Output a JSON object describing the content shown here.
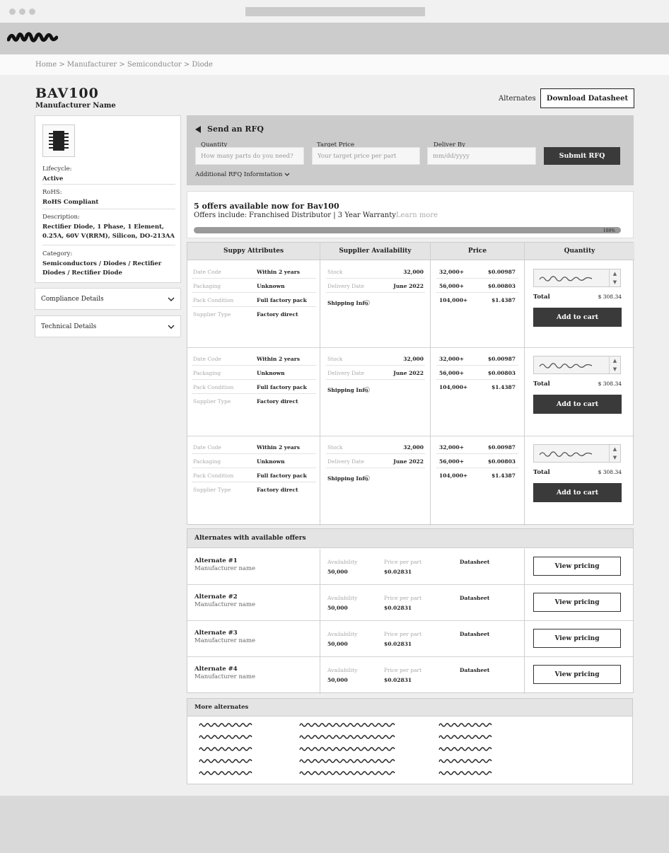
{
  "breadcrumb": "Home > Manufacturer > Semiconductor > Diode",
  "product": {
    "title": "BAV100",
    "manufacturer": "Manufacturer Name"
  },
  "header_actions": {
    "alternates": "Alternates",
    "download": "Download Datasheet"
  },
  "info": {
    "lifecycle_label": "Lifecycle:",
    "lifecycle": "Active",
    "rohs_label": "RoHS:",
    "rohs": "RoHS Compliant",
    "description_label": "Description:",
    "description": "Rectifier Diode, 1 Phase, 1 Element, 0.25A, 60V V(RRM), Silicon, DO-213AA",
    "category_label": "Category:",
    "category": "Semiconductors / Diodes / Rectifier Diodes / Rectifier Diode"
  },
  "accordions": [
    "Compliance Details",
    "Technical Details"
  ],
  "rfq": {
    "title": "Send an RFQ",
    "fields": [
      {
        "label": "Quantity",
        "placeholder": "How many parts do you need?"
      },
      {
        "label": "Target Price",
        "placeholder": "Your target price per part"
      },
      {
        "label": "Deliver By",
        "placeholder": "mm/dd/yyyy"
      }
    ],
    "submit": "Submit RFQ",
    "additional": "Additional RFQ Informtation"
  },
  "offers_summary": {
    "title": "5 offers available now for Bav100",
    "subtitle": "Offers include: Franchised Distributor |  3 Year Warranty",
    "learn_more": "Learn more",
    "progress": 100,
    "progress_label": "100%"
  },
  "offer_grid": {
    "headers": [
      "Suppy Attributes",
      "Supplier Availability",
      "Price",
      "Quantity"
    ],
    "rows": [
      {
        "attributes": [
          [
            "Date Code",
            "Within 2 years"
          ],
          [
            "Packaging",
            "Unknown"
          ],
          [
            "Pack Condition",
            "Full factory pack"
          ],
          [
            "Supplier Type",
            "Factory direct"
          ]
        ],
        "availability": [
          [
            "Stock",
            "32,000"
          ],
          [
            "Delivery Date",
            "June 2022"
          ]
        ],
        "shipping": "Shipping Info",
        "prices": [
          [
            "32,000+",
            "$0.00987"
          ],
          [
            "56,000+",
            "$0.00803"
          ],
          [
            "104,000+",
            "$1.4387"
          ]
        ],
        "total_label": "Total",
        "total": "$ 308.34",
        "cart": "Add to cart"
      },
      {
        "attributes": [
          [
            "Date Code",
            "Within 2 years"
          ],
          [
            "Packaging",
            "Unknown"
          ],
          [
            "Pack Condition",
            "Full factory pack"
          ],
          [
            "Supplier Type",
            "Factory direct"
          ]
        ],
        "availability": [
          [
            "Stock",
            "32,000"
          ],
          [
            "Delivery Date",
            "June 2022"
          ]
        ],
        "shipping": "Shipping Info",
        "prices": [
          [
            "32,000+",
            "$0.00987"
          ],
          [
            "56,000+",
            "$0.00803"
          ],
          [
            "104,000+",
            "$1.4387"
          ]
        ],
        "total_label": "Total",
        "total": "$ 308.34",
        "cart": "Add to cart"
      },
      {
        "attributes": [
          [
            "Date Code",
            "Within 2 years"
          ],
          [
            "Packaging",
            "Unknown"
          ],
          [
            "Pack Condition",
            "Full factory pack"
          ],
          [
            "Supplier Type",
            "Factory direct"
          ]
        ],
        "availability": [
          [
            "Stock",
            "32,000"
          ],
          [
            "Delivery Date",
            "June 2022"
          ]
        ],
        "shipping": "Shipping Info",
        "prices": [
          [
            "32,000+",
            "$0.00987"
          ],
          [
            "56,000+",
            "$0.00803"
          ],
          [
            "104,000+",
            "$1.4387"
          ]
        ],
        "total_label": "Total",
        "total": "$ 308.34",
        "cart": "Add to cart"
      }
    ]
  },
  "alternates": {
    "title": "Alternates with available offers",
    "items": [
      {
        "name": "Alternate #1",
        "mfr": "Manufacturer name",
        "avail_label": "Availability",
        "avail": "50,000",
        "price_label": "Price per part",
        "price": "$0.02831",
        "datasheet": "Datasheet",
        "button": "View pricing"
      },
      {
        "name": "Alternate #2",
        "mfr": "Manufacturer name",
        "avail_label": "Availability",
        "avail": "50,000",
        "price_label": "Price per part",
        "price": "$0.02831",
        "datasheet": "Datasheet",
        "button": "View pricing"
      },
      {
        "name": "Alternate #3",
        "mfr": "Manufacturer name",
        "avail_label": "Availability",
        "avail": "50,000",
        "price_label": "Price per part",
        "price": "$0.02831",
        "datasheet": "Datasheet",
        "button": "View pricing"
      },
      {
        "name": "Alternate #4",
        "mfr": "Manufacturer name",
        "avail_label": "Availability",
        "avail": "50,000",
        "price_label": "Price per part",
        "price": "$0.02831",
        "datasheet": "Datasheet",
        "button": "View pricing"
      }
    ]
  },
  "more_alternates": {
    "title": "More alternates"
  },
  "icons": {
    "chip": "chip-icon",
    "chevron": "chevron-down-icon",
    "info": "info-icon",
    "rfq": "send-icon"
  }
}
